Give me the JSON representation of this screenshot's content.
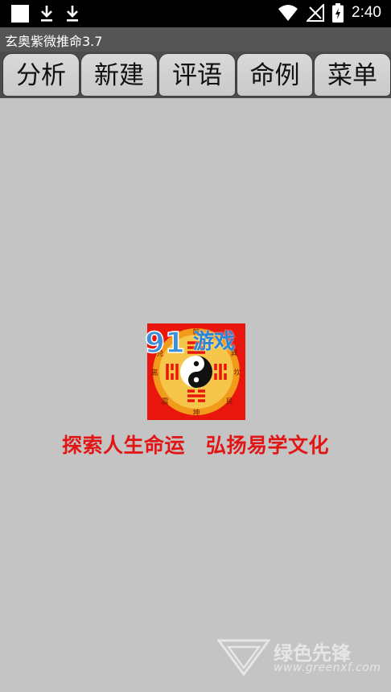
{
  "status_bar": {
    "time": "2:40",
    "icons": [
      "notification-square-icon",
      "download-icon",
      "download-icon",
      "wifi-icon",
      "signal-icon",
      "battery-icon"
    ]
  },
  "app_title": "玄奥紫微推命3.7",
  "tabs": [
    {
      "label": "分析"
    },
    {
      "label": "新建"
    },
    {
      "label": "评语"
    },
    {
      "label": "命例"
    },
    {
      "label": "菜单"
    }
  ],
  "splash": {
    "watermark_text": "游戏",
    "bagua_labels": [
      "乾",
      "巽",
      "坎",
      "艮",
      "坤",
      "震",
      "离",
      "兑"
    ],
    "slogan_left": "探索人生命运",
    "slogan_right": "弘扬易学文化"
  },
  "watermark": {
    "title": "绿色先锋",
    "url": "www.greenxf.com"
  },
  "colors": {
    "background": "#c4c4c4",
    "title_bar": "#555555",
    "tab_bar": "#4c4c4c",
    "slogan": "#e21515",
    "logo_red": "#e8160c",
    "logo_orange": "#f29a1a"
  }
}
